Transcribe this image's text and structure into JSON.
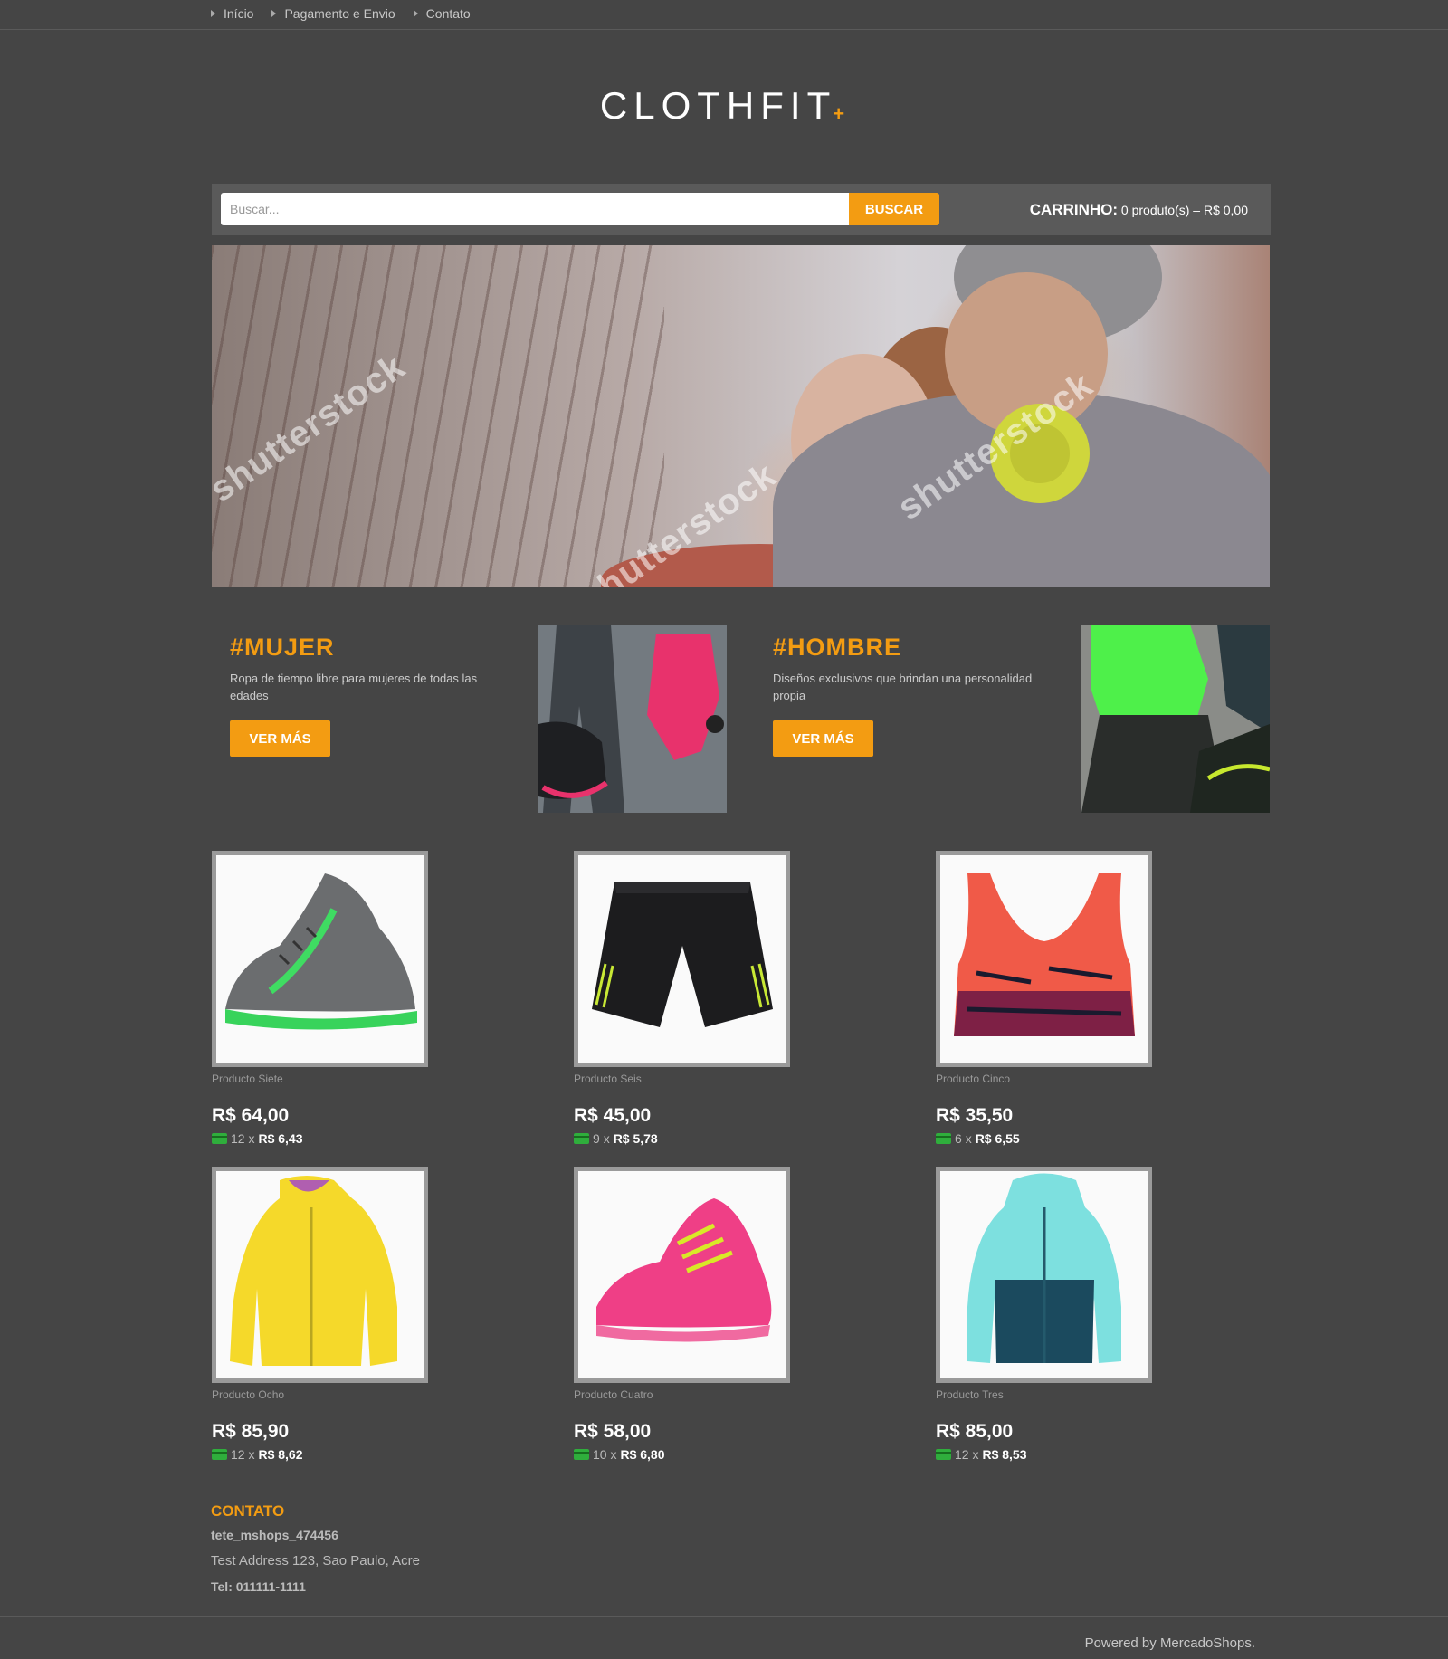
{
  "nav": {
    "items": [
      {
        "label": "Início"
      },
      {
        "label": "Pagamento e Envio"
      },
      {
        "label": "Contato"
      }
    ]
  },
  "logo": {
    "text": "CLOTHFIT",
    "mark": "+"
  },
  "search": {
    "placeholder": "Buscar...",
    "button_label": "BUSCAR"
  },
  "cart": {
    "label": "CARRINHO:",
    "summary": "0 produto(s) – R$ 0,00"
  },
  "hero": {
    "watermark": "shutterstock"
  },
  "categories": [
    {
      "title": "#MUJER",
      "description": "Ropa de tiempo libre para mujeres de todas las edades",
      "button_label": "VER MÁS"
    },
    {
      "title": "#HOMBRE",
      "description": "Diseños exclusivos que brindan una personalidad propia",
      "button_label": "VER MÁS"
    }
  ],
  "products": [
    {
      "name": "Producto Siete",
      "price": "R$ 64,00",
      "installments": "12",
      "installment_value": "R$ 6,43",
      "icon": "sneaker-gray-icon"
    },
    {
      "name": "Producto Seis",
      "price": "R$ 45,00",
      "installments": "9",
      "installment_value": "R$ 5,78",
      "icon": "shorts-icon"
    },
    {
      "name": "Producto Cinco",
      "price": "R$ 35,50",
      "installments": "6",
      "installment_value": "R$ 6,55",
      "icon": "sports-bra-icon"
    },
    {
      "name": "Producto Ocho",
      "price": "R$ 85,90",
      "installments": "12",
      "installment_value": "R$ 8,62",
      "icon": "yellow-jacket-icon"
    },
    {
      "name": "Producto Cuatro",
      "price": "R$ 58,00",
      "installments": "10",
      "installment_value": "R$ 6,80",
      "icon": "pink-sneaker-icon"
    },
    {
      "name": "Producto Tres",
      "price": "R$ 85,00",
      "installments": "12",
      "installment_value": "R$ 8,53",
      "icon": "hoodie-icon"
    }
  ],
  "installment_sep": "x",
  "contact": {
    "heading": "CONTATO",
    "shop": "tete_mshops_474456",
    "address": "Test Address 123, Sao Paulo, Acre",
    "phone": "Tel: 011111-1111"
  },
  "footer": {
    "powered": "Powered by MercadoShops."
  },
  "colors": {
    "accent": "#f39c12",
    "background": "#454545",
    "bar": "#5a5a5a"
  }
}
